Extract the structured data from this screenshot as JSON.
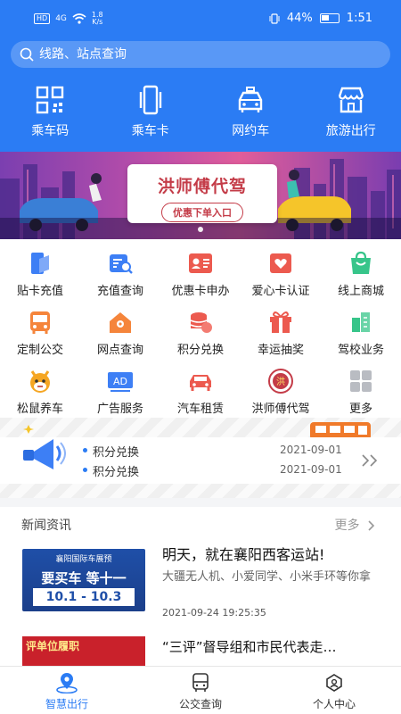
{
  "status_bar": {
    "hd": "HD",
    "network": "4G",
    "speed_top": "1.8",
    "speed_unit": "K/s",
    "battery": "44%",
    "time": "1:51"
  },
  "search": {
    "placeholder": "线路、站点查询"
  },
  "top_nav": [
    {
      "label": "乘车码",
      "icon": "qr-code-icon"
    },
    {
      "label": "乘车卡",
      "icon": "card-phone-icon"
    },
    {
      "label": "网约车",
      "icon": "car-icon"
    },
    {
      "label": "旅游出行",
      "icon": "shop-icon"
    }
  ],
  "banner": {
    "title": "洪师傅代驾",
    "button": "优惠下单入口"
  },
  "grid": [
    {
      "label": "贴卡充值",
      "icon": "card-recharge-icon",
      "color": "#3d7ff5"
    },
    {
      "label": "充值查询",
      "icon": "recharge-search-icon",
      "color": "#3d7ff5"
    },
    {
      "label": "优惠卡申办",
      "icon": "discount-card-icon",
      "color": "#ec5a4f"
    },
    {
      "label": "爱心卡认证",
      "icon": "heart-card-icon",
      "color": "#ec5a4f"
    },
    {
      "label": "线上商城",
      "icon": "shopping-bag-icon",
      "color": "#37c58a"
    },
    {
      "label": "定制公交",
      "icon": "bus-icon",
      "color": "#f5853b"
    },
    {
      "label": "网点查询",
      "icon": "house-location-icon",
      "color": "#f5853b"
    },
    {
      "label": "积分兑换",
      "icon": "coins-icon",
      "color": "#ec5a4f"
    },
    {
      "label": "幸运抽奖",
      "icon": "gift-icon",
      "color": "#ec5a4f"
    },
    {
      "label": "驾校业务",
      "icon": "driving-school-icon",
      "color": "#37c58a"
    },
    {
      "label": "松鼠养车",
      "icon": "squirrel-icon",
      "color": "#f5a623"
    },
    {
      "label": "广告服务",
      "icon": "ad-icon",
      "color": "#3d7ff5",
      "icon_text": "AD"
    },
    {
      "label": "汽车租赁",
      "icon": "rental-car-icon",
      "color": "#ec5a4f"
    },
    {
      "label": "洪师傅代驾",
      "icon": "hong-logo-icon",
      "color": "#c43c48",
      "icon_text": "洪"
    },
    {
      "label": "更多",
      "icon": "more-grid-icon",
      "color": "#b9bcc2"
    }
  ],
  "notices": [
    {
      "text": "积分兑换",
      "date": "2021-09-01"
    },
    {
      "text": "积分兑换",
      "date": "2021-09-01"
    }
  ],
  "news": {
    "header": "新闻资讯",
    "more": "更多",
    "items": [
      {
        "title": "明天，就在襄阳西客运站!",
        "desc": "大疆无人机、小爱同学、小米手环等你拿",
        "time": "2021-09-24 19:25:35",
        "thumb_line1": "襄阳国际车展预",
        "thumb_line2": "要买车 等十一",
        "thumb_line3": "10.1 - 10.3"
      },
      {
        "title": "“三评”督导组和市民代表走…",
        "thumb_line1": "评单位履职"
      }
    ]
  },
  "tabbar": [
    {
      "label": "智慧出行",
      "active": true
    },
    {
      "label": "公交查询",
      "active": false
    },
    {
      "label": "个人中心",
      "active": false
    }
  ]
}
